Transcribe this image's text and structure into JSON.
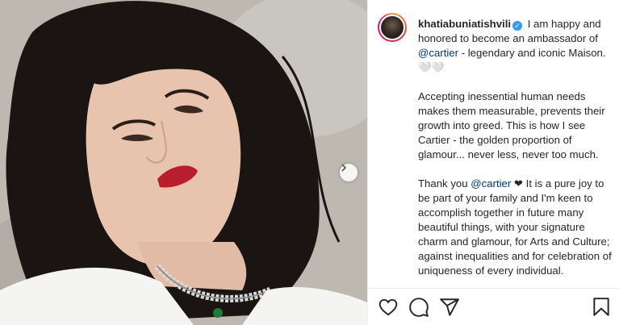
{
  "post": {
    "username": "khatiabuniatishvili",
    "verified": true,
    "caption_p1_a": " I am happy and honored to become an ambassador of ",
    "caption_p1_mention": "@cartier",
    "caption_p1_b": " - legendary and iconic Maison. 🤍🤍",
    "caption_p2": "Accepting inessential human needs makes them measurable, prevents their growth into greed. This is how I see Cartier - the golden proportion of glamour... never less, never too much.",
    "caption_p3_a": "Thank you ",
    "caption_p3_mention": "@cartier",
    "caption_p3_b": " ❤ It is a pure joy to be part of your family and I'm keen to accomplish together in future many beautiful things, with your signature charm and glamour, for Arts and Culture; against inequalities and for celebration of uniqueness of every individual."
  },
  "actions": {
    "like": "heart-icon",
    "comment": "comment-icon",
    "share": "paper-plane-icon",
    "save": "bookmark-icon"
  },
  "media": {
    "next": "chevron-right-icon"
  },
  "colors": {
    "mention": "#00376b",
    "verified": "#3897f0",
    "text": "#262626"
  }
}
